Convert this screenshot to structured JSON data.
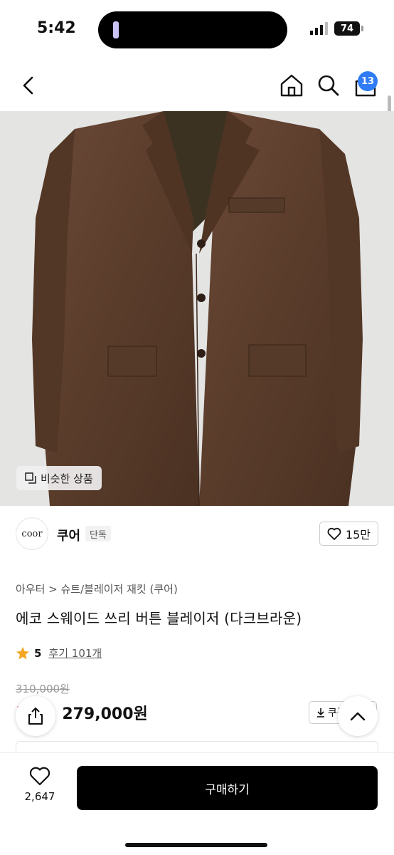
{
  "status_bar": {
    "time": "5:42",
    "battery": "74"
  },
  "nav": {
    "cart_count": "13",
    "icons": [
      "back-chevron-icon",
      "home-icon",
      "search-icon",
      "shopping-bag-icon"
    ]
  },
  "image": {
    "similar_label": "비슷한 상품"
  },
  "brand": {
    "logo_text": "coor",
    "name": "쿠어",
    "tag": "단독",
    "likes": "15만"
  },
  "product": {
    "category": "아우터 > 슈트/블레이저 재킷 (쿠어)",
    "title": "에코 스웨이드 쓰리 버튼 블레이저 (다크브라운)",
    "rating": "5",
    "reviews": "후기 101개",
    "original_price": "310,000원",
    "discount": "1",
    "sale_price": "279,000원",
    "coupon_label": "쿠폰"
  },
  "bottom": {
    "wish_count": "2,647",
    "buy_label": "구매하기"
  },
  "colors": {
    "accent": "#2f7cf6",
    "discount": "#e5422b",
    "star": "#f5a623",
    "jacket": "#5a3c2b"
  }
}
